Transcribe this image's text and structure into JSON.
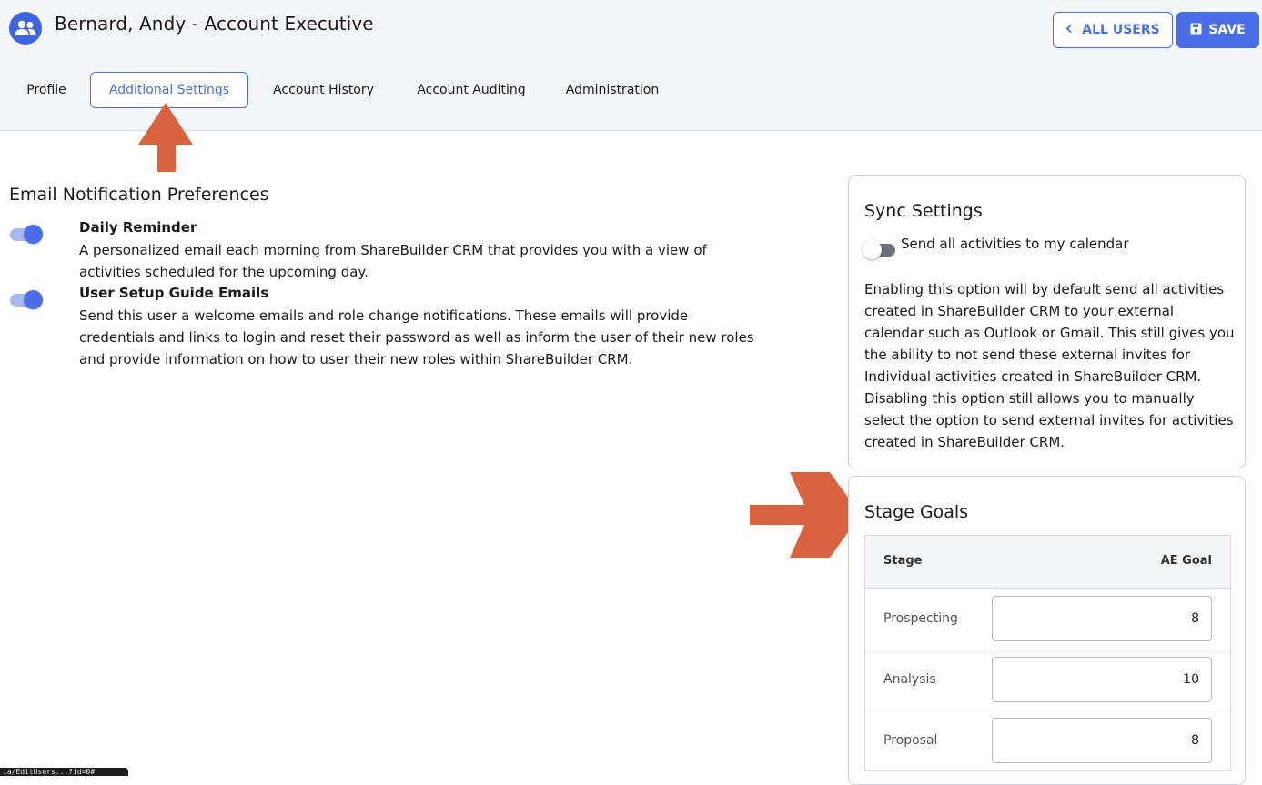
{
  "header": {
    "title": "Bernard, Andy - Account Executive",
    "all_users_label": "ALL USERS",
    "save_label": "SAVE"
  },
  "tabs": [
    {
      "label": "Profile",
      "active": false
    },
    {
      "label": "Additional Settings",
      "active": true
    },
    {
      "label": "Account History",
      "active": false
    },
    {
      "label": "Account Auditing",
      "active": false
    },
    {
      "label": "Administration",
      "active": false
    }
  ],
  "email_prefs": {
    "title": "Email Notification Preferences",
    "items": [
      {
        "title": "Daily Reminder",
        "description": "A personalized email each morning from ShareBuilder CRM that provides you with a view of activities scheduled for the upcoming day.",
        "enabled": true
      },
      {
        "title": "User Setup Guide Emails",
        "description": "Send this user a welcome emails and role change notifications. These emails will provide credentials and links to login and reset their password as well as inform the user of their new roles and provide information on how to user their new roles within ShareBuilder CRM.",
        "enabled": true
      }
    ]
  },
  "sync": {
    "title": "Sync Settings",
    "toggle_label": "Send all activities to my calendar",
    "enabled": false,
    "description": "Enabling this option will by default send all activities created in ShareBuilder CRM to your external calendar such as Outlook or Gmail. This still gives you the ability to not send these external invites for Individual activities created in ShareBuilder CRM. Disabling this option still allows you to manually select the option to send external invites for activities created in ShareBuilder CRM."
  },
  "stage_goals": {
    "title": "Stage Goals",
    "col_stage": "Stage",
    "col_goal": "AE Goal",
    "rows": [
      {
        "stage": "Prospecting",
        "goal": "8"
      },
      {
        "stage": "Analysis",
        "goal": "10"
      },
      {
        "stage": "Proposal",
        "goal": "8"
      }
    ]
  },
  "status_bar_text": "ia/EditUsers...?id=0#",
  "colors": {
    "accent": "#4a6ee8",
    "annotation_arrow": "#d9633f"
  }
}
